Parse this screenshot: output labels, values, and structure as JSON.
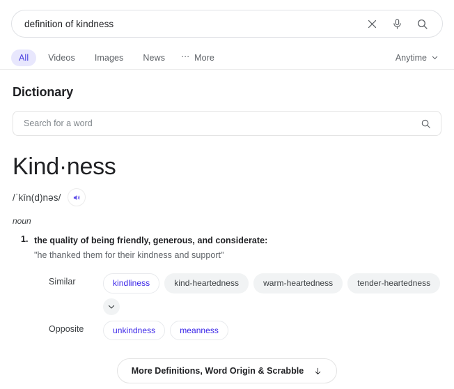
{
  "search": {
    "query": "definition of kindness",
    "icons": [
      "close-icon",
      "microphone-icon",
      "search-icon"
    ]
  },
  "tabs": {
    "items": [
      {
        "label": "All",
        "active": true
      },
      {
        "label": "Videos",
        "active": false
      },
      {
        "label": "Images",
        "active": false
      },
      {
        "label": "News",
        "active": false
      }
    ],
    "more_label": "More",
    "filter_label": "Anytime"
  },
  "dictionary": {
    "section_title": "Dictionary",
    "word_search_placeholder": "Search for a word",
    "word_search_value": "",
    "headword": "Kind·ness",
    "pronunciation": "/ˈkīn(d)nəs/",
    "audio_label": "speaker-icon",
    "part_of_speech": "noun",
    "definitions": [
      {
        "number": "1.",
        "text": "the quality of being friendly, generous, and considerate:",
        "example": "\"he thanked them for their kindness and support\""
      }
    ],
    "similar": {
      "label": "Similar",
      "chips": [
        {
          "text": "kindliness",
          "style": "link"
        },
        {
          "text": "kind-heartedness",
          "style": "plain"
        },
        {
          "text": "warm-heartedness",
          "style": "plain"
        },
        {
          "text": "tender-heartedness",
          "style": "plain"
        }
      ],
      "expand_icon": "chevron-down-icon"
    },
    "opposite": {
      "label": "Opposite",
      "chips": [
        {
          "text": "unkindness",
          "style": "link"
        },
        {
          "text": "meanness",
          "style": "link"
        }
      ]
    },
    "more_button": {
      "label": "More Definitions, Word Origin & Scrabble",
      "icon": "arrow-down-icon"
    }
  },
  "colors": {
    "accent_purple": "#4b40e0",
    "link_purple": "#3a25e8",
    "tab_active_bg": "#e8e7fd",
    "chip_gray_bg": "#f1f3f4",
    "text_primary": "#202124",
    "text_secondary": "#5f6368"
  }
}
